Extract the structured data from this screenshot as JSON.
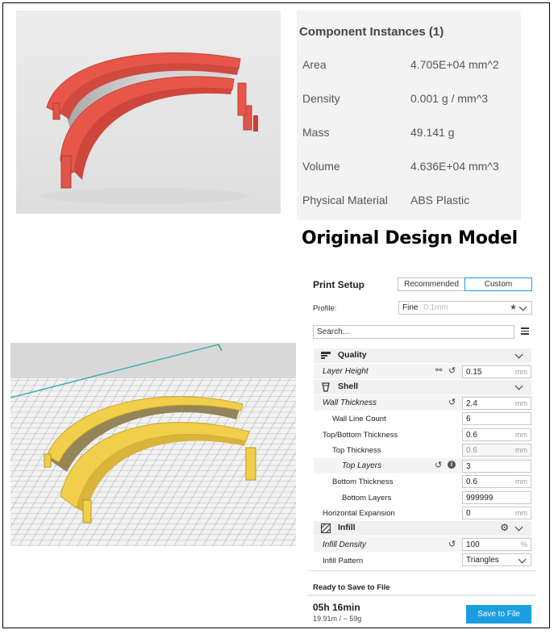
{
  "properties": {
    "header": "Component Instances (1)",
    "rows": [
      {
        "key": "Area",
        "value": "4.705E+04 mm^2"
      },
      {
        "key": "Density",
        "value": "0.001 g / mm^3"
      },
      {
        "key": "Mass",
        "value": "49.141 g"
      },
      {
        "key": "Volume",
        "value": "4.636E+04 mm^3"
      },
      {
        "key": "Physical Material",
        "value": "ABS Plastic"
      }
    ]
  },
  "caption": "Original Design Model",
  "print_setup": {
    "title": "Print Setup",
    "mode_recommended": "Recommended",
    "mode_custom": "Custom",
    "profile_label": "Profile:",
    "profile_value": "Fine",
    "profile_hint": "0.1mm",
    "search_placeholder": "Search...",
    "sections": {
      "quality": "Quality",
      "shell": "Shell",
      "infill": "Infill"
    },
    "settings": {
      "layer_height": {
        "label": "Layer Height",
        "value": "0.15",
        "unit": "mm"
      },
      "wall_thickness": {
        "label": "Wall Thickness",
        "value": "2.4",
        "unit": "mm"
      },
      "wall_line_count": {
        "label": "Wall Line Count",
        "value": "6"
      },
      "top_bottom_thickness": {
        "label": "Top/Bottom Thickness",
        "value": "0.6",
        "unit": "mm"
      },
      "top_thickness": {
        "label": "Top Thickness",
        "value": "0.6",
        "unit": "mm"
      },
      "top_layers": {
        "label": "Top Layers",
        "value": "3"
      },
      "bottom_thickness": {
        "label": "Bottom Thickness",
        "value": "0.6",
        "unit": "mm"
      },
      "bottom_layers": {
        "label": "Bottom Layers",
        "value": "999999"
      },
      "horizontal_expansion": {
        "label": "Horizontal Expansion",
        "value": "0",
        "unit": "mm"
      },
      "infill_density": {
        "label": "Infill Density",
        "value": "100",
        "unit": "%"
      },
      "infill_pattern": {
        "label": "Infill Pattern",
        "value": "Triangles"
      }
    },
    "status": "Ready to Save to File",
    "print_time": "05h 16min",
    "material_usage": "19.91m / ~ 59g",
    "save_button": "Save to File"
  },
  "colors": {
    "part_red": "#e8564a",
    "part_yellow": "#f2cf4a",
    "accent_blue": "#1a9ee0"
  }
}
